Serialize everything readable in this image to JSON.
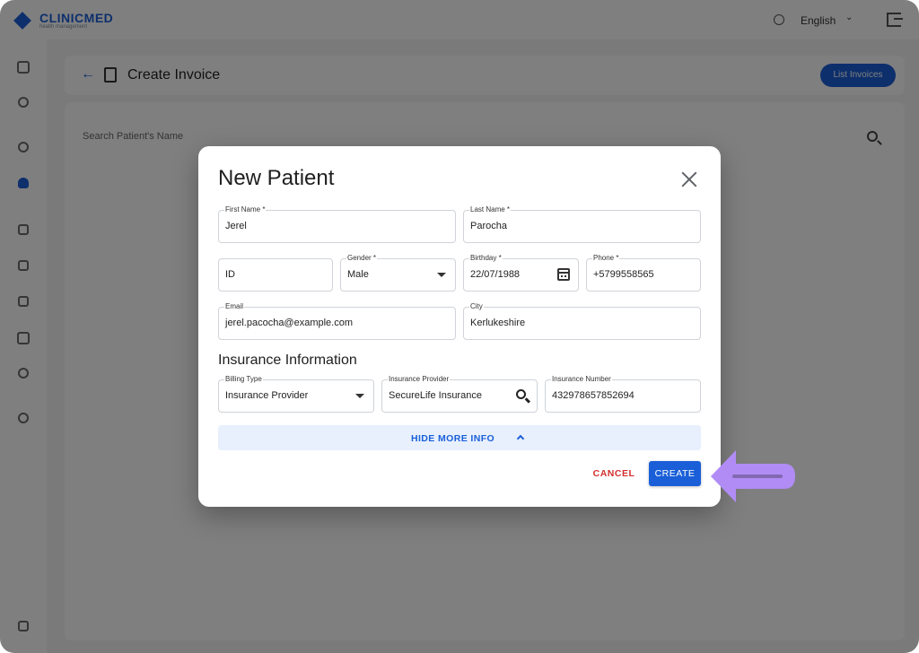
{
  "colors": {
    "accent": "#1a5fd8",
    "danger": "#d32f2f",
    "arrow": "#b18cf5"
  },
  "app": {
    "logo_text": "CLINICMED",
    "logo_sub": "health management",
    "language": "English",
    "header_title": "Create Invoice",
    "list_button": "List Invoices",
    "search_placeholder": "Search Patient's Name"
  },
  "modal": {
    "title": "New Patient",
    "fields": {
      "first_name": {
        "label": "First Name *",
        "value": "Jerel"
      },
      "last_name": {
        "label": "Last Name *",
        "value": "Parocha"
      },
      "id": {
        "label": "",
        "value": "ID"
      },
      "gender": {
        "label": "Gender *",
        "value": "Male"
      },
      "birthday": {
        "label": "Birthday *",
        "value": "22/07/1988"
      },
      "phone": {
        "label": "Phone *",
        "value": "+5799558565"
      },
      "email": {
        "label": "Email",
        "value": "jerel.pacocha@example.com"
      },
      "city": {
        "label": "City",
        "value": "Kerlukeshire"
      }
    },
    "insurance_section_title": "Insurance Information",
    "insurance": {
      "billing_type": {
        "label": "Billing Type",
        "value": "Insurance Provider"
      },
      "provider": {
        "label": "Insurance Provider",
        "value": "SecureLife Insurance"
      },
      "number": {
        "label": "Insurance Number",
        "value": "432978657852694"
      }
    },
    "toggle_label": "HIDE MORE INFO",
    "cancel_label": "CANCEL",
    "create_label": "CREATE"
  }
}
